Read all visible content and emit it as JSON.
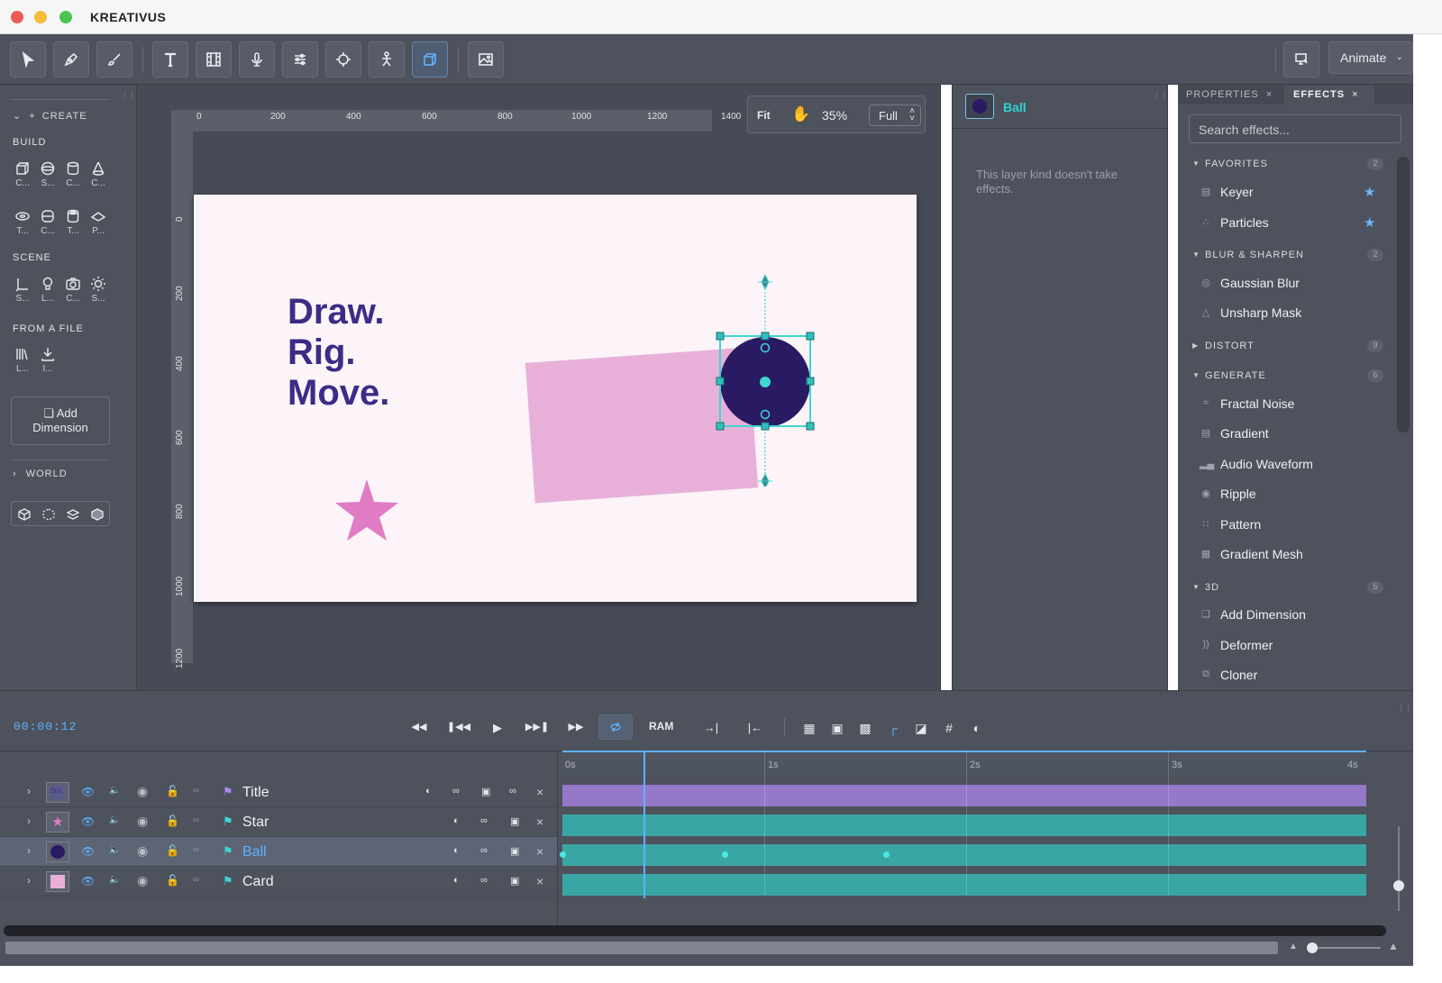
{
  "app": {
    "title": "KREATIVUS"
  },
  "toolbar": {
    "mode_label": "Animate",
    "tools": [
      "select-tool",
      "pen-tool",
      "brush-tool",
      "text-tool",
      "film-tool",
      "mic-tool",
      "sliders-tool",
      "target-tool",
      "puppet-tool",
      "3d-tool",
      "image-tool",
      "monitor-tool"
    ]
  },
  "left_panel": {
    "create_label": "CREATE",
    "build_label": "BUILD",
    "build_items": [
      "C...",
      "S...",
      "C...",
      "C...",
      "T...",
      "C...",
      "T...",
      "P..."
    ],
    "scene_label": "SCENE",
    "scene_items": [
      "S...",
      "L...",
      "C...",
      "S..."
    ],
    "file_label": "FROM A FILE",
    "file_items": [
      "L...",
      "I..."
    ],
    "add_dimension_line1": "Add",
    "add_dimension_line2": "Dimension",
    "world_label": "WORLD"
  },
  "canvas": {
    "zoom_fit_label": "Fit",
    "zoom_percent": "35%",
    "quality": "Full",
    "ruler_h": [
      "0",
      "200",
      "400",
      "600",
      "800",
      "1000",
      "1200",
      "1400"
    ],
    "ruler_v": [
      "0",
      "200",
      "400",
      "600",
      "800",
      "1000",
      "1200"
    ],
    "headline": [
      "Draw.",
      "Rig.",
      "Move."
    ]
  },
  "layer_panel": {
    "layer_name": "Ball",
    "message": "This layer kind doesn't take effects."
  },
  "effects_panel": {
    "tab_properties": "PROPERTIES",
    "tab_effects": "EFFECTS",
    "search_placeholder": "Search effects...",
    "categories": [
      {
        "name": "FAVORITES",
        "count": "2",
        "items": [
          "Keyer",
          "Particles"
        ]
      },
      {
        "name": "BLUR & SHARPEN",
        "count": "2",
        "items": [
          "Gaussian Blur",
          "Unsharp Mask"
        ]
      },
      {
        "name": "DISTORT",
        "count": "9",
        "items": []
      },
      {
        "name": "GENERATE",
        "count": "6",
        "items": [
          "Fractal Noise",
          "Gradient",
          "Audio Waveform",
          "Ripple",
          "Pattern",
          "Gradient Mesh"
        ]
      },
      {
        "name": "3D",
        "count": "5",
        "items": [
          "Add Dimension",
          "Deformer",
          "Cloner"
        ]
      }
    ]
  },
  "timeline": {
    "timecode": "00:00:12",
    "ram_label": "RAM",
    "ticks": [
      "0s",
      "1s",
      "2s",
      "3s",
      "4s"
    ],
    "layers": [
      {
        "name": "Title",
        "flag_color": "#a98cf0"
      },
      {
        "name": "Star",
        "flag_color": "#3fd6d2"
      },
      {
        "name": "Ball",
        "flag_color": "#3fd6d2"
      },
      {
        "name": "Card",
        "flag_color": "#3fd6d2"
      }
    ]
  },
  "colors": {
    "accent": "#5fb2ff",
    "selection": "#2fd3d0",
    "headline": "#3d2c87",
    "ball": "#2a1a63",
    "star": "#e07cc4",
    "card": "#e8b0d8"
  }
}
